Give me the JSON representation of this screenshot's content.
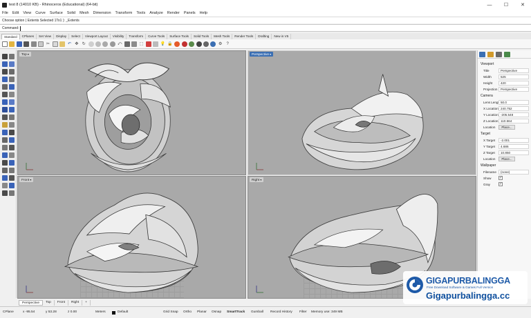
{
  "window": {
    "title": "test 8 (14010 KB) - Rhinoceros (Educational) (64-bit)",
    "controls": {
      "minimize": "—",
      "maximize": "☐",
      "close": "✕"
    }
  },
  "menubar": {
    "items": [
      "File",
      "Edit",
      "View",
      "Curve",
      "Surface",
      "Solid",
      "Mesh",
      "Dimension",
      "Transform",
      "Tools",
      "Analyze",
      "Render",
      "Panels",
      "Help"
    ]
  },
  "command": {
    "history": "Choose option ( Extents  Selected  1To1 ): _Extents",
    "prompt": "Command:"
  },
  "toolbar_tabs": {
    "items": [
      "Standard",
      "CPlanes",
      "Set View",
      "Display",
      "Select",
      "Viewport Layout",
      "Visibility",
      "Transform",
      "Curve Tools",
      "Surface Tools",
      "Solid Tools",
      "Mesh Tools",
      "Render Tools",
      "Drafting",
      "New in V5"
    ],
    "active_index": 0
  },
  "viewports": {
    "top": {
      "label": "Top"
    },
    "perspective": {
      "label": "Perspective"
    },
    "front": {
      "label": "Front"
    },
    "right": {
      "label": "Right"
    }
  },
  "viewport_tabs": {
    "items": [
      "Perspective",
      "Top",
      "Front",
      "Right",
      "+"
    ],
    "active_index": 0
  },
  "properties": {
    "viewport_section": "Viewport",
    "viewport_rows": [
      {
        "label": "Title",
        "value": "Perspective"
      },
      {
        "label": "Width",
        "value": "525"
      },
      {
        "label": "Height",
        "value": "420"
      },
      {
        "label": "Projection",
        "value": "Perspective"
      }
    ],
    "camera_section": "Camera",
    "camera_rows": [
      {
        "label": "Lens Length",
        "value": "50.0"
      },
      {
        "label": "X Location",
        "value": "240.752"
      },
      {
        "label": "Y Location",
        "value": "-205.548"
      },
      {
        "label": "Z Location",
        "value": "110.564"
      }
    ],
    "camera_location": {
      "label": "Location",
      "button": "Place..."
    },
    "target_section": "Target",
    "target_rows": [
      {
        "label": "X Target",
        "value": "-2.001"
      },
      {
        "label": "Y Target",
        "value": "4.686"
      },
      {
        "label": "Z Target",
        "value": "10.850"
      }
    ],
    "target_location": {
      "label": "Location",
      "button": "Place..."
    },
    "wallpaper_section": "Wallpaper",
    "wallpaper_filename": {
      "label": "Filename",
      "value": "(none)"
    },
    "wallpaper_show": {
      "label": "Show",
      "check": "✓"
    },
    "wallpaper_gray": {
      "label": "Gray",
      "check": "✓"
    }
  },
  "statusbar": {
    "cplane": "CPlane",
    "x": "x -95.54",
    "y": "y 53.28",
    "z": "z 0.00",
    "units": "Meters",
    "layer": "Default",
    "grid_snap": "Grid Snap",
    "ortho": "Ortho",
    "planar": "Planar",
    "osnap": "Osnap",
    "smarttrack": "SmartTrack",
    "gumball": "Gumball",
    "record_history": "Record History",
    "filter": "Filter",
    "memory": "Memory use: 349 MB"
  },
  "watermark": {
    "name": "GIGAPURBALINGGA",
    "tagline": "Free Download Software & Games Full Version",
    "url": "Gigapurbalingga.cc"
  },
  "colors": {
    "viewport_bg": "#a9a9a9",
    "active_label": "#3b6fb3",
    "brand_blue": "#1e5aa8"
  }
}
